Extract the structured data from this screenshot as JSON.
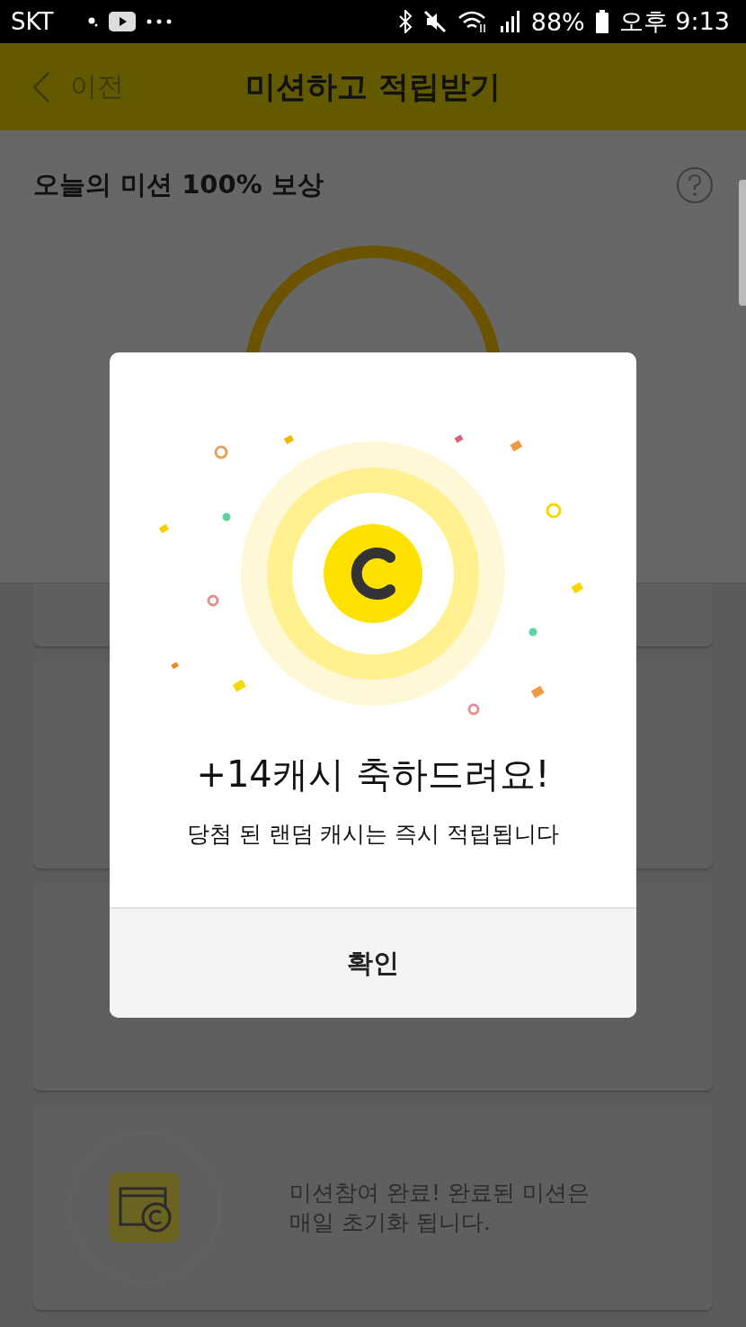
{
  "status_bar": {
    "carrier": "SKT",
    "battery": "88%",
    "time": "오후 9:13"
  },
  "header": {
    "back_label": "이전",
    "title": "미션하고 적립받기"
  },
  "summary": {
    "title": "오늘의 미션 100% 보상"
  },
  "missions": [
    {
      "kind": "hidden"
    },
    {
      "kind": "hidden"
    },
    {
      "kind": "hidden"
    },
    {
      "kind": "done",
      "text": "미션참여 완료!  완료된 미션은\n매일 초기화 됩니다."
    }
  ],
  "dialog": {
    "title": "+14캐시 축하드려요!",
    "message": "당첨 된 랜덤 캐시는 즉시 적립됩니다",
    "button": "확인"
  }
}
